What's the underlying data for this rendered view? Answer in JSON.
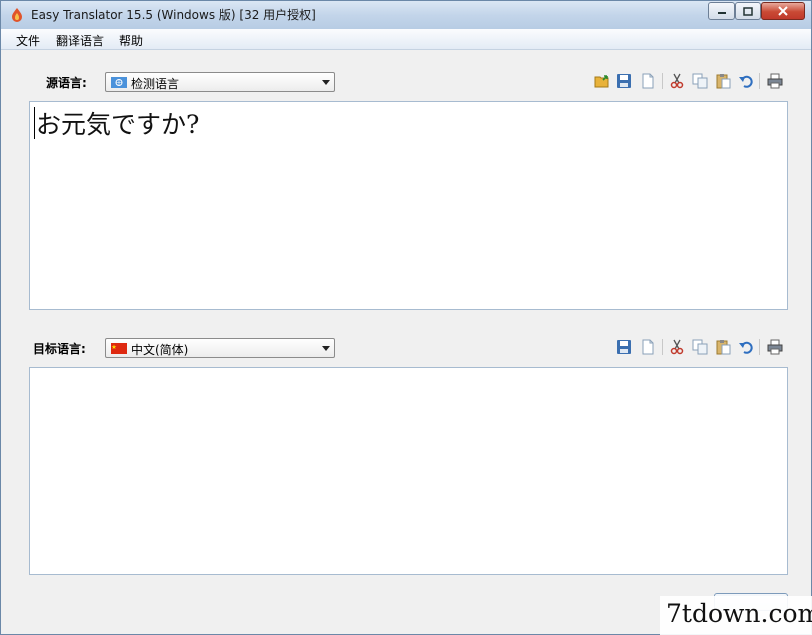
{
  "window": {
    "title": "Easy Translator 15.5 (Windows 版) [32 用户授权]"
  },
  "menu": {
    "items": [
      "文件",
      "翻译语言",
      "帮助"
    ]
  },
  "source": {
    "label": "源语言:",
    "selected": "检测语言",
    "text": "お元気ですか?"
  },
  "target": {
    "label": "目标语言:",
    "selected": "中文(简体)",
    "text": ""
  },
  "icons": {
    "source_toolbar": [
      "open-icon",
      "save-icon",
      "new-icon",
      "cut-icon",
      "copy-icon",
      "paste-icon",
      "undo-icon",
      "print-icon"
    ],
    "target_toolbar": [
      "save-icon",
      "new-icon",
      "cut-icon",
      "copy-icon",
      "paste-icon",
      "undo-icon",
      "print-icon"
    ]
  },
  "watermark": {
    "text": "7tdown.com"
  }
}
